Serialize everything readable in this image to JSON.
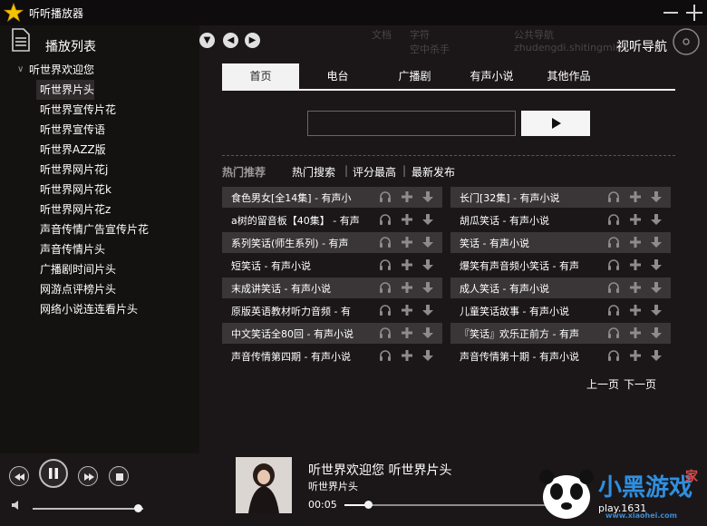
{
  "app": {
    "title": "听听播放器"
  },
  "sidebar": {
    "title": "播放列表",
    "root": "听世界欢迎您",
    "items": [
      "听世界片头",
      "听世界宣传片花",
      "听世界宣传语",
      "听世界AZZ版",
      "听世界网片花j",
      "听世界网片花k",
      "听世界网片花z",
      "声音传情广告宣传片花",
      "声音传情片头",
      "广播剧时间片头",
      "网游点评榜片头",
      "网络小说连连看片头"
    ],
    "selected_index": 0
  },
  "nav": {
    "title": "视听导航",
    "ghost": [
      "文档",
      "字符",
      "公共导航",
      "空中杀手",
      "zhudengdi.shitingmin"
    ]
  },
  "tabs": [
    "首页",
    "电台",
    "广播剧",
    "有声小说",
    "其他作品"
  ],
  "search": {
    "value": "",
    "placeholder": ""
  },
  "hot": {
    "label": "热门推荐",
    "filters": [
      "热门搜索",
      "评分最高",
      "最新发布"
    ]
  },
  "list_left": [
    "食色男女[全14集] - 有声小",
    "a树的留音板【40集】 - 有声",
    "系列笑话(师生系列) - 有声",
    "短笑话 - 有声小说",
    "末成讲笑话 - 有声小说",
    "原版英语教材听力音频 - 有",
    "中文笑话全80回 - 有声小说",
    "声音传情第四期 - 有声小说"
  ],
  "list_right": [
    "长门[32集] - 有声小说",
    "胡瓜笑话 - 有声小说",
    "笑话 - 有声小说",
    "爆笑有声音频小笑话 - 有声",
    "成人笑话 - 有声小说",
    "儿童笑话故事 - 有声小说",
    "『笑话』欢乐正前方 - 有声",
    "声音传情第十期 - 有声小说"
  ],
  "pager": {
    "prev": "上一页",
    "next": "下一页"
  },
  "player": {
    "title": "听世界欢迎您  听世界片头",
    "subtitle": "听世界片头",
    "time": "00:05",
    "progress": 0.11,
    "volume": 0.95
  },
  "watermark": {
    "text": "小黑游戏",
    "site": "www.xiaohei.com",
    "sub": "家",
    "sub2": "play.1631"
  },
  "colors": {
    "bg": "#1b1718",
    "sidebar": "#141111",
    "row_dark": "#3a3637",
    "accent": "#f2f2f2"
  }
}
